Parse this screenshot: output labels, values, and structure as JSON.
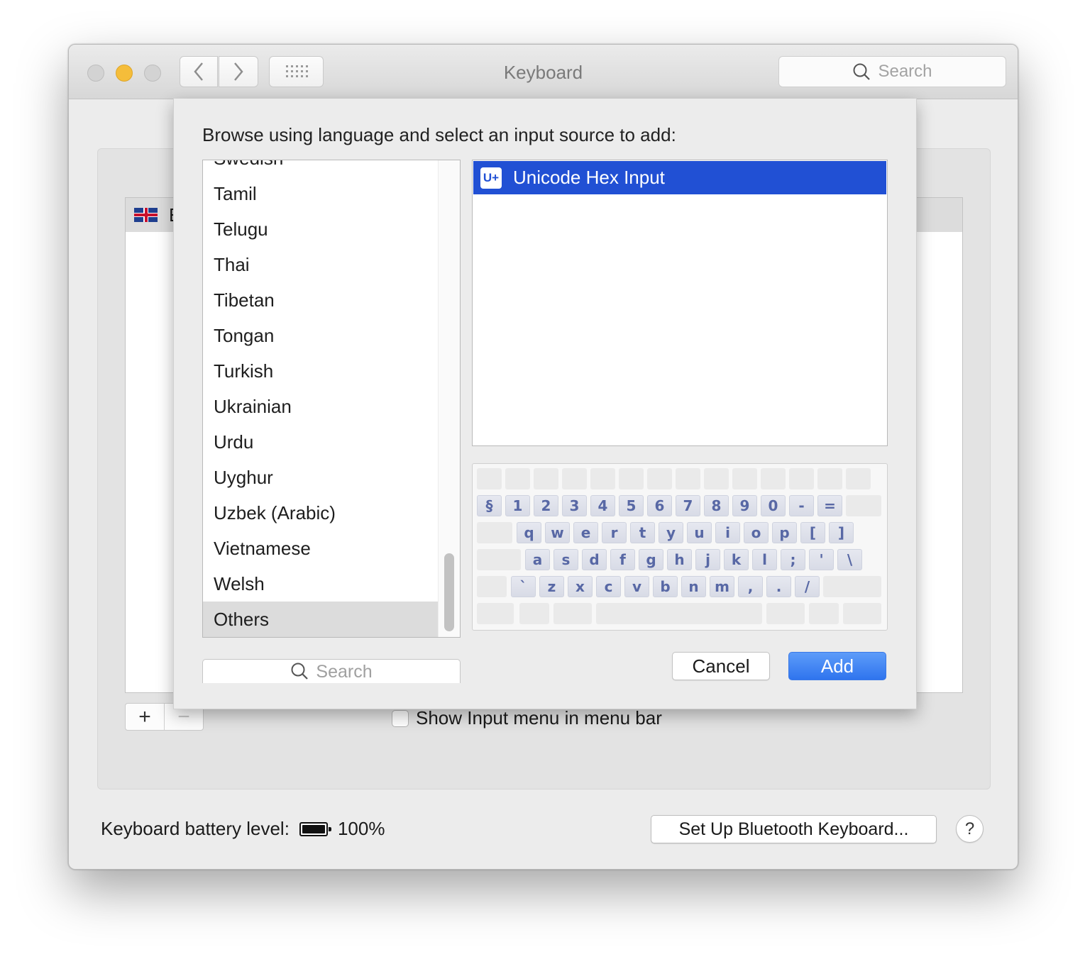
{
  "window": {
    "title": "Keyboard",
    "search_placeholder": "Search"
  },
  "background": {
    "list_first_item": "E",
    "add_label": "+",
    "remove_label": "−",
    "show_input_menu_label": "Show Input menu in menu bar",
    "battery_label": "Keyboard battery level:",
    "battery_value": "100%",
    "bluetooth_button": "Set Up Bluetooth Keyboard...",
    "help_label": "?"
  },
  "sheet": {
    "title": "Browse using language and select an input source to add:",
    "languages": [
      "Swedish",
      "Tamil",
      "Telugu",
      "Thai",
      "Tibetan",
      "Tongan",
      "Turkish",
      "Ukrainian",
      "Urdu",
      "Uyghur",
      "Uzbek (Arabic)",
      "Vietnamese",
      "Welsh",
      "Others"
    ],
    "selected_language": "Others",
    "search_placeholder": "Search",
    "input_sources": [
      {
        "label": "Unicode Hex Input",
        "icon": "U+",
        "selected": true
      }
    ],
    "keyboard_rows": [
      [
        "§",
        "1",
        "2",
        "3",
        "4",
        "5",
        "6",
        "7",
        "8",
        "9",
        "0",
        "-",
        "="
      ],
      [
        "q",
        "w",
        "e",
        "r",
        "t",
        "y",
        "u",
        "i",
        "o",
        "p",
        "[",
        "]"
      ],
      [
        "a",
        "s",
        "d",
        "f",
        "g",
        "h",
        "j",
        "k",
        "l",
        ";",
        "'",
        "\\"
      ],
      [
        "`",
        "z",
        "x",
        "c",
        "v",
        "b",
        "n",
        "m",
        ",",
        ".",
        "/"
      ]
    ],
    "cancel_label": "Cancel",
    "add_label": "Add",
    "accent_color": "#2150d4"
  }
}
